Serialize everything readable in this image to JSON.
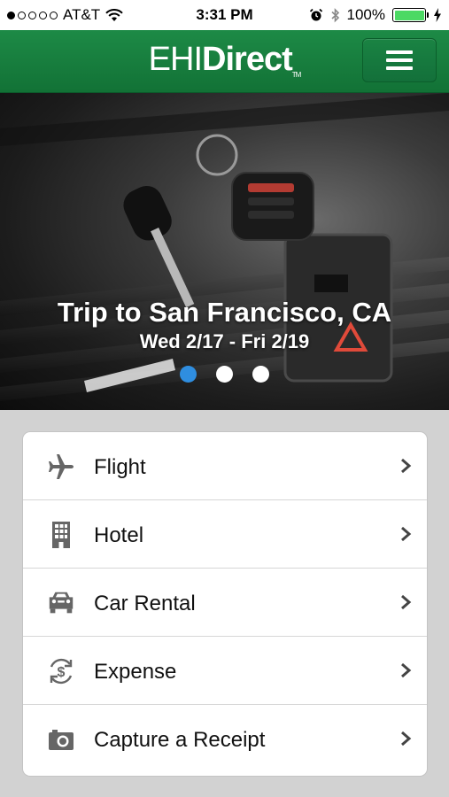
{
  "status_bar": {
    "carrier": "AT&T",
    "time": "3:31 PM",
    "battery": "100%",
    "battery_level": 1.0
  },
  "header": {
    "logo_light": "EHI",
    "logo_bold": "Direct",
    "logo_tm": "TM",
    "menu_icon": "hamburger-menu-icon"
  },
  "hero": {
    "title": "Trip to San Francisco, CA",
    "dates": "Wed 2/17 - Fri 2/19",
    "pages": 3,
    "active_page": 1
  },
  "menu": {
    "items": [
      {
        "label": "Flight",
        "icon": "airplane-icon"
      },
      {
        "label": "Hotel",
        "icon": "building-icon"
      },
      {
        "label": "Car Rental",
        "icon": "car-icon"
      },
      {
        "label": "Expense",
        "icon": "dollar-cycle-icon"
      },
      {
        "label": "Capture a Receipt",
        "icon": "camera-icon"
      }
    ]
  },
  "colors": {
    "header_green": "#1a8040",
    "active_dot": "#2f8ee0",
    "battery_green": "#4cd964",
    "icon_gray": "#666666"
  }
}
